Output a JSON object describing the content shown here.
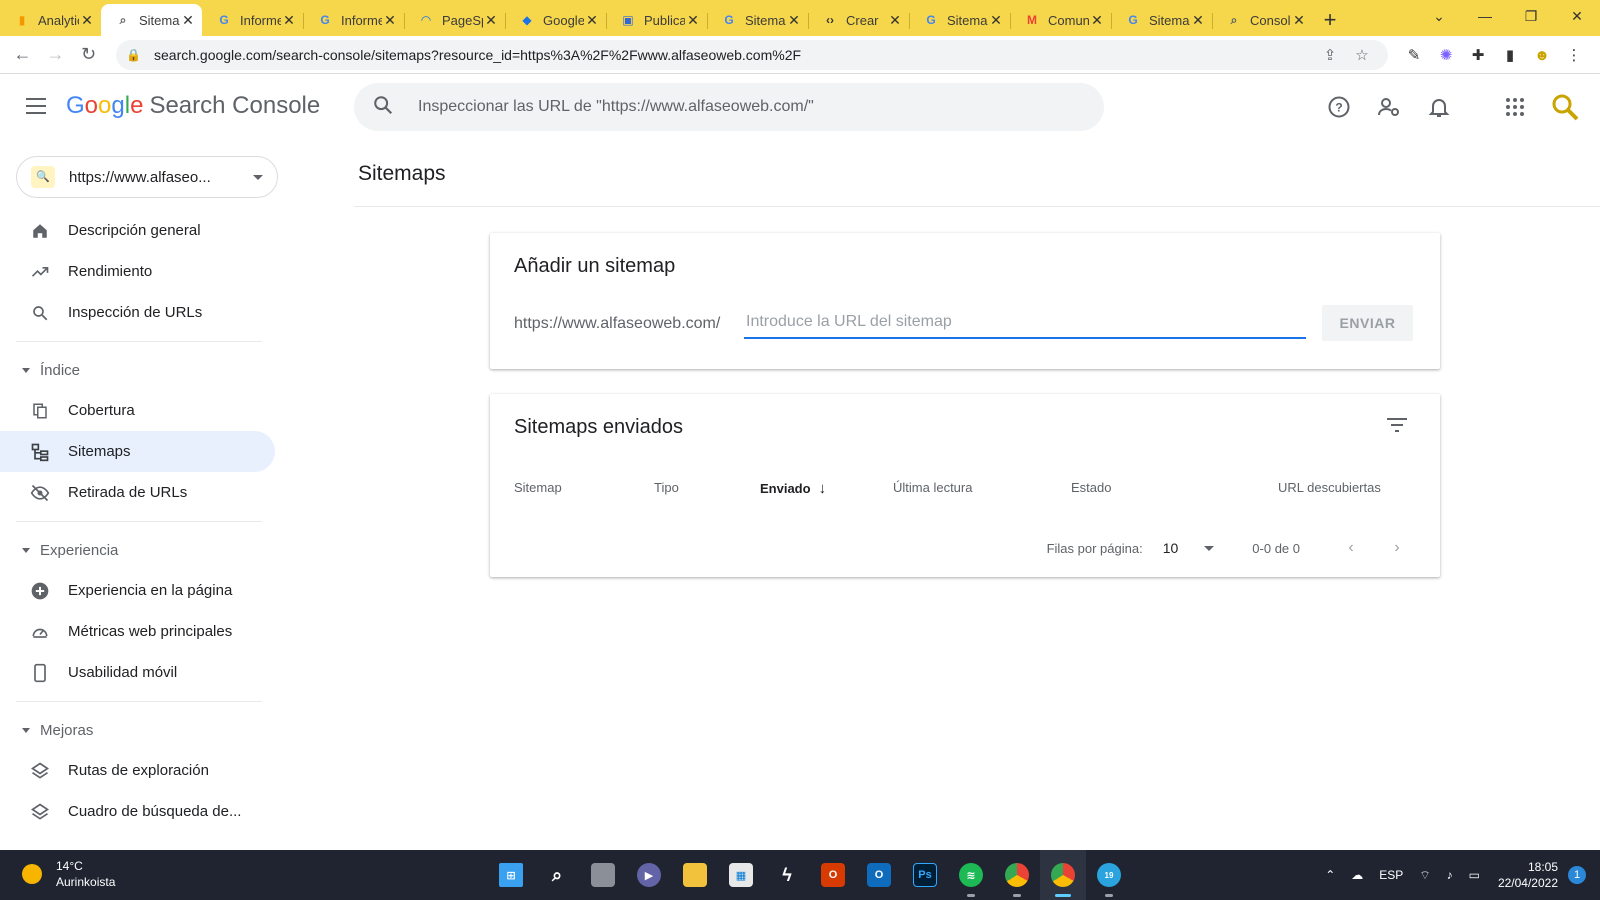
{
  "browser": {
    "tabs": [
      {
        "title": "Analytics",
        "icon": "analytics-icon",
        "active": false
      },
      {
        "title": "Sitemaps",
        "icon": "search-console-icon",
        "active": true
      },
      {
        "title": "Informe",
        "icon": "google-icon",
        "active": false
      },
      {
        "title": "Informe",
        "icon": "google-icon",
        "active": false
      },
      {
        "title": "PageSpeed",
        "icon": "pagespeed-icon",
        "active": false
      },
      {
        "title": "Google",
        "icon": "google-ads-icon",
        "active": false
      },
      {
        "title": "Publicar",
        "icon": "publisher-icon",
        "active": false
      },
      {
        "title": "Sitemaps",
        "icon": "google-icon",
        "active": false
      },
      {
        "title": "Crear",
        "icon": "code-icon",
        "active": false
      },
      {
        "title": "Sitemaps",
        "icon": "google-icon",
        "active": false
      },
      {
        "title": "Comunidad",
        "icon": "gmail-icon",
        "active": false
      },
      {
        "title": "Sitemaps",
        "icon": "google-icon",
        "active": false
      },
      {
        "title": "Consola",
        "icon": "search-console-icon",
        "active": false
      }
    ],
    "url": "search.google.com/search-console/sitemaps?resource_id=https%3A%2F%2Fwww.alfaseoweb.com%2F"
  },
  "header": {
    "brand_google": [
      "G",
      "o",
      "o",
      "g",
      "l",
      "e"
    ],
    "brand_product": "Search Console",
    "search_placeholder": "Inspeccionar las URL de \"https://www.alfaseoweb.com/\""
  },
  "sidebar": {
    "property": "https://www.alfaseo...",
    "items_top": [
      {
        "label": "Descripción general",
        "icon": "home-icon"
      },
      {
        "label": "Rendimiento",
        "icon": "trending-up-icon"
      },
      {
        "label": "Inspección de URLs",
        "icon": "search-icon"
      }
    ],
    "section_index": "Índice",
    "items_index": [
      {
        "label": "Cobertura",
        "icon": "file-copy-icon"
      },
      {
        "label": "Sitemaps",
        "icon": "sitemap-icon",
        "selected": true
      },
      {
        "label": "Retirada de URLs",
        "icon": "visibility-off-icon"
      }
    ],
    "section_experience": "Experiencia",
    "items_experience": [
      {
        "label": "Experiencia en la página",
        "icon": "add-circle-icon"
      },
      {
        "label": "Métricas web principales",
        "icon": "speed-icon"
      },
      {
        "label": "Usabilidad móvil",
        "icon": "phone-icon"
      }
    ],
    "section_improvements": "Mejoras",
    "items_improvements": [
      {
        "label": "Rutas de exploración",
        "icon": "layers-icon"
      },
      {
        "label": "Cuadro de búsqueda de...",
        "icon": "layers-icon"
      }
    ]
  },
  "main": {
    "title": "Sitemaps",
    "add_card": {
      "title": "Añadir un sitemap",
      "prefix": "https://www.alfaseoweb.com/",
      "placeholder": "Introduce la URL del sitemap",
      "submit": "ENVIAR"
    },
    "sent_card": {
      "title": "Sitemaps enviados",
      "columns": [
        "Sitemap",
        "Tipo",
        "Enviado",
        "Última lectura",
        "Estado",
        "URL descubiertas"
      ],
      "sorted_column": "Enviado",
      "rows_per_page_label": "Filas por página:",
      "rows_per_page": "10",
      "range": "0-0 de 0"
    }
  },
  "taskbar": {
    "temp": "14°C",
    "weather": "Aurinkoista",
    "lang": "ESP",
    "time": "18:05",
    "date": "22/04/2022",
    "notifications": "1",
    "telegram_badge": "19"
  }
}
